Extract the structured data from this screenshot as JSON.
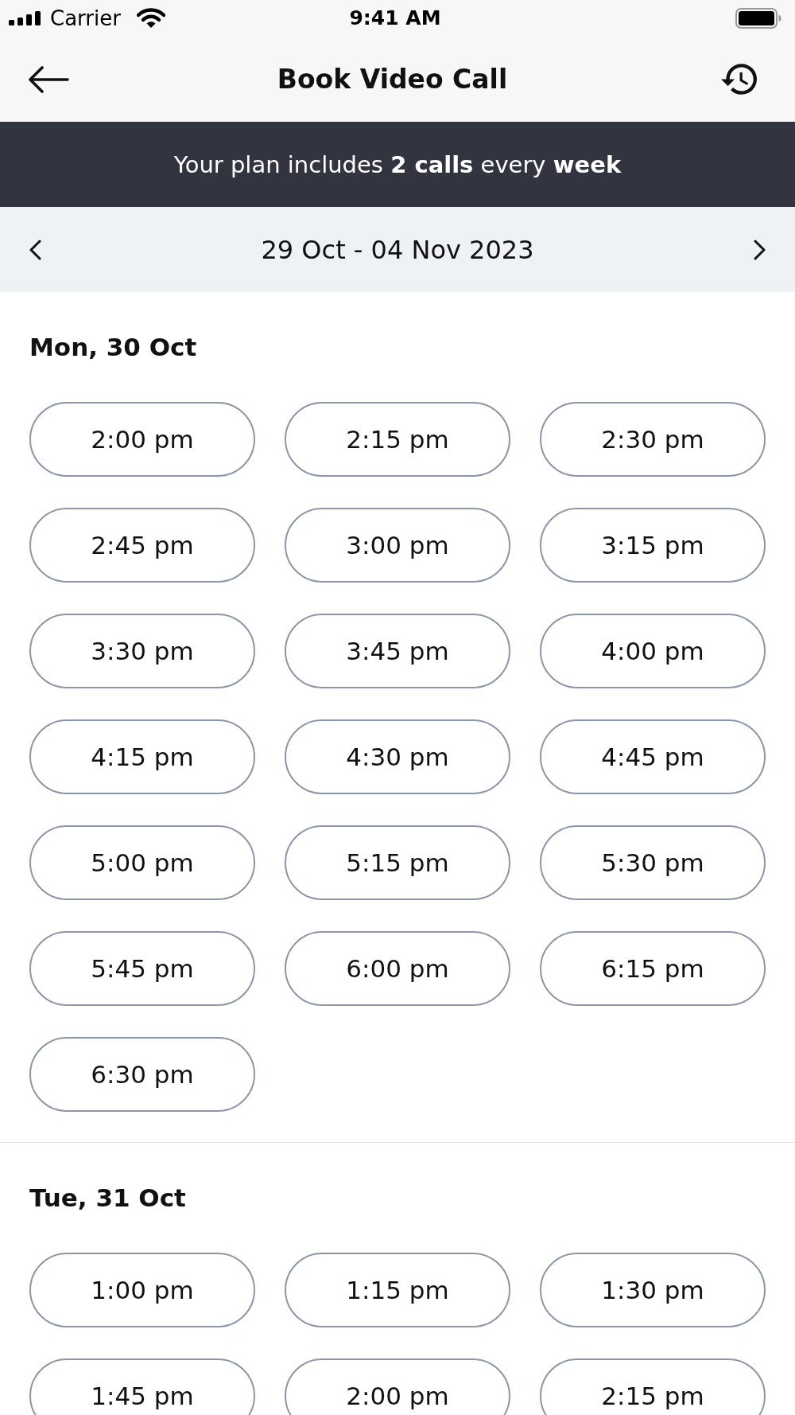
{
  "status_bar": {
    "carrier": "Carrier",
    "time": "9:41 AM"
  },
  "header": {
    "title": "Book Video Call"
  },
  "banner": {
    "text": "Your plan includes **2 calls** every **week**"
  },
  "week_nav": {
    "range": "29 Oct - 04 Nov 2023"
  },
  "days": [
    {
      "title": "Mon, 30 Oct",
      "slots": [
        {
          "time": "2:00 pm",
          "selected": false
        },
        {
          "time": "2:15 pm",
          "selected": false
        },
        {
          "time": "2:30 pm",
          "selected": false
        },
        {
          "time": "2:45 pm",
          "selected": false
        },
        {
          "time": "3:00 pm",
          "selected": false
        },
        {
          "time": "3:15 pm",
          "selected": false
        },
        {
          "time": "3:30 pm",
          "selected": false
        },
        {
          "time": "3:45 pm",
          "selected": false
        },
        {
          "time": "4:00 pm",
          "selected": false
        },
        {
          "time": "4:15 pm",
          "selected": false
        },
        {
          "time": "4:30 pm",
          "selected": false
        },
        {
          "time": "4:45 pm",
          "selected": false
        },
        {
          "time": "5:00 pm",
          "selected": false
        },
        {
          "time": "5:15 pm",
          "selected": false
        },
        {
          "time": "5:30 pm",
          "selected": false
        },
        {
          "time": "5:45 pm",
          "selected": false
        },
        {
          "time": "6:00 pm",
          "selected": false
        },
        {
          "time": "6:15 pm",
          "selected": false
        },
        {
          "time": "6:30 pm",
          "selected": false
        }
      ]
    },
    {
      "title": "Tue, 31 Oct",
      "slots": [
        {
          "time": "1:00 pm",
          "selected": false
        },
        {
          "time": "1:15 pm",
          "selected": false
        },
        {
          "time": "1:30 pm",
          "selected": false
        },
        {
          "time": "1:45 pm",
          "selected": false
        },
        {
          "time": "2:00 pm",
          "selected": false
        },
        {
          "time": "2:15 pm",
          "selected": false
        }
      ]
    }
  ]
}
